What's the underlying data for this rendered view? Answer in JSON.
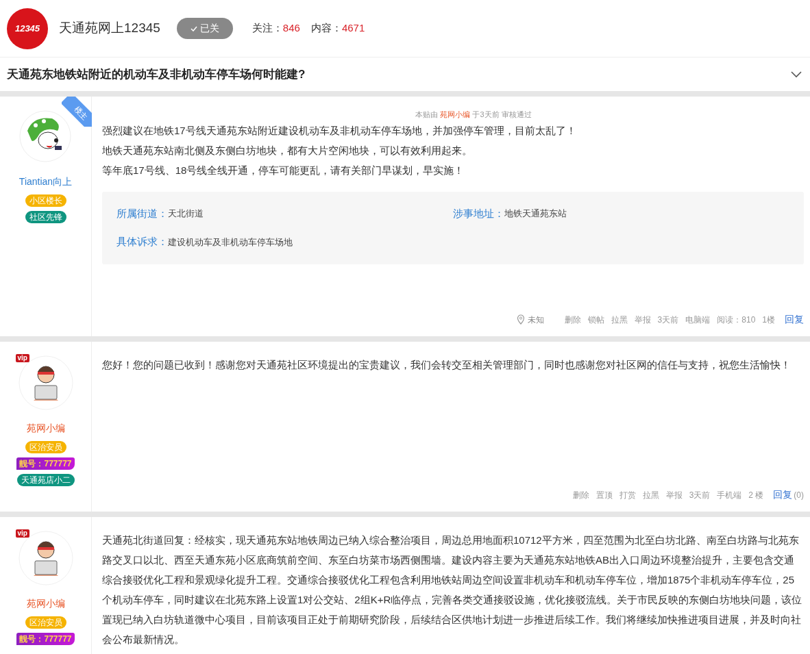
{
  "header": {
    "logo_text": "12345",
    "channel_name": "天通苑网上12345",
    "follow_button": {
      "label": "已关",
      "followed": true
    },
    "stats": [
      {
        "label": "关注：",
        "value": "846"
      },
      {
        "label": "内容：",
        "value": "4671"
      }
    ]
  },
  "thread_title": "天通苑东地铁站附近的机动车及非机动车停车场何时能建?",
  "posts": [
    {
      "author": {
        "name": "Tiantian向上",
        "color": "#2f7fd0",
        "kind": "mascot",
        "badges": [
          {
            "label": "小区楼长",
            "kind": "pill",
            "color": "#f5b300"
          },
          {
            "label": "社区先锋",
            "kind": "pill",
            "color": "#0f9580"
          }
        ]
      },
      "corner_label": "楼主",
      "review_note": {
        "prefix": "本贴由",
        "editor": "苑网小编",
        "suffix": "于3天前 审核通过"
      },
      "paragraphs": [
        "强烈建议在地铁17号线天通苑东站附近建设机动车及非机动车停车场地，并加强停车管理，目前太乱了！",
        "地铁天通苑东站南北侧及东侧白坊地块，都有大片空闲地块，可以有效利用起来。",
        "等年底17号线、18号线全线开通，停车可能更乱，请有关部门早谋划，早实施！"
      ],
      "details": [
        {
          "label": "所属街道：",
          "value": "天北街道"
        },
        {
          "label": "涉事地址：",
          "value": "地铁天通苑东站"
        },
        {
          "label": "具体诉求：",
          "value": "建设机动车及非机动车停车场地"
        }
      ],
      "footer": [
        {
          "kind": "location",
          "text": "未知"
        },
        {
          "kind": "action",
          "text": "删除"
        },
        {
          "kind": "action",
          "text": "锁帖"
        },
        {
          "kind": "action",
          "text": "拉黑"
        },
        {
          "kind": "action",
          "text": "举报"
        },
        {
          "kind": "info",
          "text": "3天前"
        },
        {
          "kind": "info",
          "text": "电脑端"
        },
        {
          "kind": "info",
          "text": "阅读：810"
        },
        {
          "kind": "info",
          "text": "1楼"
        },
        {
          "kind": "reply",
          "text": "回复"
        }
      ]
    },
    {
      "author": {
        "name": "苑网小编",
        "color": "#e8572a",
        "kind": "cartoon",
        "vip_tag": "vip",
        "badges": [
          {
            "label": "区治安员",
            "kind": "pill",
            "color": "#f5b300"
          },
          {
            "label": "靓号：777777",
            "kind": "number",
            "color": "#c41ad6"
          },
          {
            "label": "天通苑店小二",
            "kind": "pill",
            "color": "#0f9580"
          }
        ]
      },
      "paragraphs": [
        "您好！您的问题已收到！感谢您对天通苑社区环境提出的宝贵建议，我们会转交至相关管理部门，同时也感谢您对社区网的信任与支持，祝您生活愉快！"
      ],
      "footer": [
        {
          "kind": "action",
          "text": "删除"
        },
        {
          "kind": "action",
          "text": "置顶"
        },
        {
          "kind": "action",
          "text": "打赏"
        },
        {
          "kind": "action",
          "text": "拉黑"
        },
        {
          "kind": "info",
          "text": "举报"
        },
        {
          "kind": "info",
          "text": "3天前"
        },
        {
          "kind": "info",
          "text": "手机端"
        },
        {
          "kind": "info",
          "text": "2 楼"
        },
        {
          "kind": "reply",
          "text": "回复",
          "count": "(0)"
        }
      ]
    },
    {
      "author": {
        "name": "苑网小编",
        "color": "#e8572a",
        "kind": "cartoon",
        "vip_tag": "vip",
        "badges": [
          {
            "label": "区治安员",
            "kind": "pill",
            "color": "#f5b300"
          },
          {
            "label": "靓号：777777",
            "kind": "number",
            "color": "#c41ad6"
          }
        ]
      },
      "paragraphs": [
        "天通苑北街道回复：经核实，现天通苑东站地铁周边已纳入综合整治项目，周边总用地面积10712平方米，四至范围为北至白坊北路、南至白坊路与北苑东路交叉口以北、西至天通东苑小区底商筑前空间、东至白坊菜市场西侧围墙。建设内容主要为天通苑东站地铁AB出入口周边环境整治提升，主要包含交通综合接驳优化工程和景观绿化提升工程。交通综合接驳优化工程包含利用地铁站周边空间设置非机动车和机动车停车位，增加1875个非机动车停车位，25个机动车停车，同时建议在北苑东路上设置1对公交站、2组K+R临停点，完善各类交通接驳设施，优化接驳流线。关于市民反映的东侧白坊地块问题，该位置现已纳入白坊轨道微中心项目，目前该项目正处于前期研究阶段，后续结合区供地计划进一步推进后续工作。我们将继续加快推进项目进展，并及时向社会公布最新情况。"
      ]
    }
  ]
}
